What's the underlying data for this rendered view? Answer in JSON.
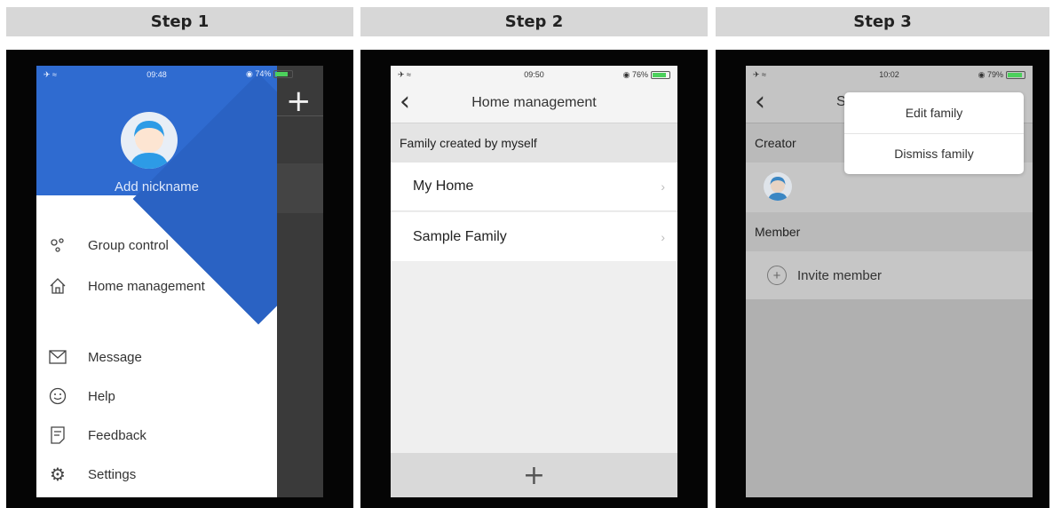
{
  "steps": [
    {
      "label": "Step 1"
    },
    {
      "label": "Step 2"
    },
    {
      "label": "Step 3"
    }
  ],
  "step1": {
    "status": {
      "time": "09:48",
      "battery": "74%"
    },
    "profile": {
      "nickname": "Add nickname"
    },
    "menu": [
      {
        "label": "Group control",
        "icon": "group-control-icon"
      },
      {
        "label": "Home management",
        "icon": "home-icon"
      },
      {
        "label": "Message",
        "icon": "envelope-icon"
      },
      {
        "label": "Help",
        "icon": "smiley-icon"
      },
      {
        "label": "Feedback",
        "icon": "feedback-icon"
      },
      {
        "label": "Settings",
        "icon": "gear-icon"
      }
    ],
    "add_label": "+"
  },
  "step2": {
    "status": {
      "time": "09:50",
      "battery": "76%"
    },
    "title": "Home management",
    "section": "Family created by myself",
    "families": [
      "My Home",
      "Sample Family"
    ],
    "add_label": "+"
  },
  "step3": {
    "status": {
      "time": "10:02",
      "battery": "79%"
    },
    "title_fragment": "S",
    "creator_label": "Creator",
    "member_label": "Member",
    "invite_label": "Invite member",
    "popup": {
      "edit": "Edit family",
      "dismiss": "Dismiss family"
    }
  },
  "colors": {
    "accent_blue": "#2f6bd0",
    "battery_green": "#4cd05c",
    "overlay_gray": "#444444"
  }
}
